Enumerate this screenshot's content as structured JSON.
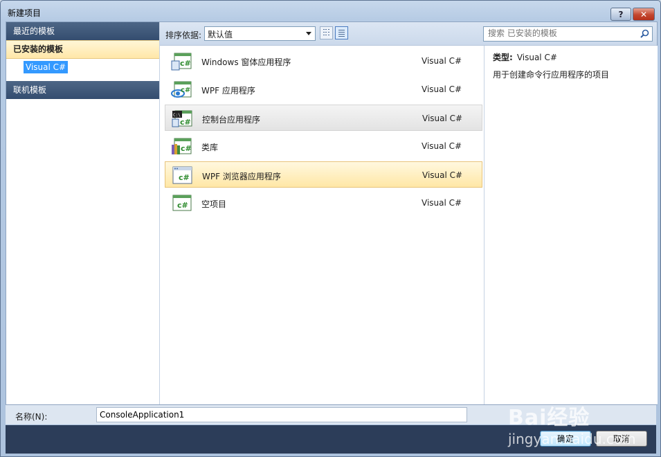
{
  "window": {
    "title": "新建项目"
  },
  "titlebar": {
    "help_label": "?",
    "close_label": "✕"
  },
  "left_panel": {
    "recent": "最近的模板",
    "installed": "已安装的模板",
    "installed_child": "Visual C#",
    "online": "联机模板"
  },
  "toolbar": {
    "sort_label": "排序依据:",
    "sort_value": "默认值",
    "search_placeholder": "搜索 已安装的模板"
  },
  "templates": [
    {
      "name": "Windows 窗体应用程序",
      "lang": "Visual C#",
      "icon": "winforms-icon"
    },
    {
      "name": "WPF 应用程序",
      "lang": "Visual C#",
      "icon": "wpf-icon"
    },
    {
      "name": "控制台应用程序",
      "lang": "Visual C#",
      "icon": "console-icon"
    },
    {
      "name": "类库",
      "lang": "Visual C#",
      "icon": "class-library-icon"
    },
    {
      "name": "WPF 浏览器应用程序",
      "lang": "Visual C#",
      "icon": "wpf-browser-icon"
    },
    {
      "name": "空项目",
      "lang": "Visual C#",
      "icon": "empty-project-icon"
    }
  ],
  "description": {
    "type_label": "类型:",
    "type_value": "Visual C#",
    "text": "用于创建命令行应用程序的项目"
  },
  "name_field": {
    "label": "名称(N):",
    "value": "ConsoleApplication1"
  },
  "buttons": {
    "ok": "确定",
    "cancel": "取消"
  },
  "watermark": {
    "line1": "Bai经验",
    "line2": "jingyan.baidu.com"
  },
  "colors": {
    "accent": "#3399ff",
    "header_dark": "#344d6f",
    "selected": "#ffe7a6",
    "footer": "#2c3d59"
  }
}
